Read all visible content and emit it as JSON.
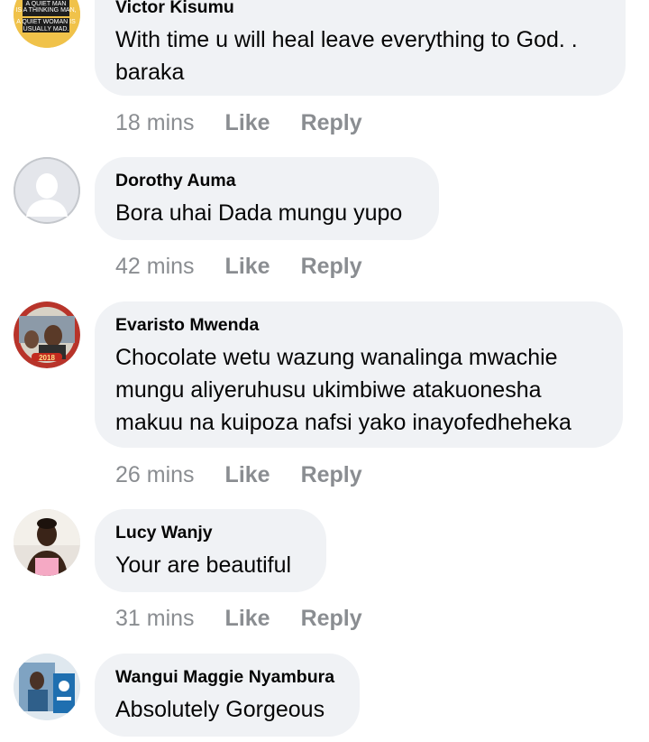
{
  "comments": [
    {
      "author": "Victor Kisumu",
      "text_lines": [
        "With time u will heal leave everything to God. .",
        "baraka"
      ],
      "time": "18 mins",
      "avatar": "quote-text-avatar",
      "avatar_text": [
        "A QUIET MAN",
        "IS A THINKING MAN,",
        "A QUIET WOMAN IS",
        "USUALLY MAD."
      ]
    },
    {
      "author": "Dorothy Auma",
      "text_lines": [
        "Bora uhai Dada mungu yupo"
      ],
      "time": "42 mins",
      "avatar": "default-profile-avatar"
    },
    {
      "author": "Evaristo Mwenda",
      "text_lines": [
        "Chocolate wetu wazung wanalinga mwachie",
        "mungu aliyeruhusu ukimbiwe atakuonesha",
        "makuu na kuipoza nafsi yako inayofedheheka"
      ],
      "time": "26 mins",
      "avatar": "photo-avatar",
      "avatar_text": [
        "2018"
      ]
    },
    {
      "author": "Lucy Wanjy",
      "text_lines": [
        "Your are beautiful"
      ],
      "time": "31 mins",
      "avatar": "photo-avatar"
    },
    {
      "author": "Wangui Maggie Nyambura",
      "text_lines": [
        "Absolutely Gorgeous"
      ],
      "time": "",
      "avatar": "photo-avatar"
    }
  ],
  "actions": {
    "like_label": "Like",
    "reply_label": "Reply"
  },
  "colors": {
    "bubble_bg": "#f0f2f5",
    "action_text": "#8a8d91",
    "text": "#050505"
  }
}
